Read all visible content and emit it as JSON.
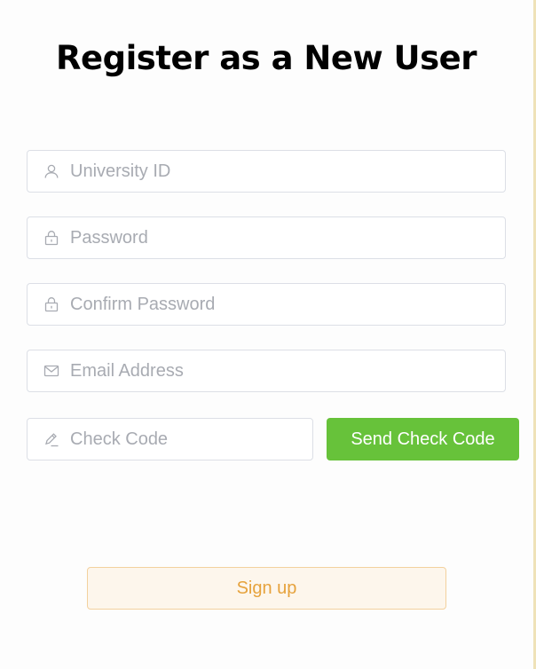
{
  "title": "Register as a New User",
  "form": {
    "university_id": {
      "placeholder": "University ID",
      "value": "",
      "icon": "user-icon"
    },
    "password": {
      "placeholder": "Password",
      "value": "",
      "icon": "lock-icon"
    },
    "confirm_password": {
      "placeholder": "Confirm Password",
      "value": "",
      "icon": "lock-icon"
    },
    "email": {
      "placeholder": "Email Address",
      "value": "",
      "icon": "mail-icon"
    },
    "check_code": {
      "placeholder": "Check Code",
      "value": "",
      "icon": "edit-pen-icon"
    }
  },
  "buttons": {
    "send_check_code": "Send Check Code",
    "sign_up": "Sign up"
  },
  "colors": {
    "success": "#67c23a",
    "warning_text": "#e6a23c",
    "warning_bg": "#fdf6ec",
    "warning_border": "#f3d19e",
    "input_border": "#dcdfe6",
    "placeholder": "#a8abb2"
  }
}
